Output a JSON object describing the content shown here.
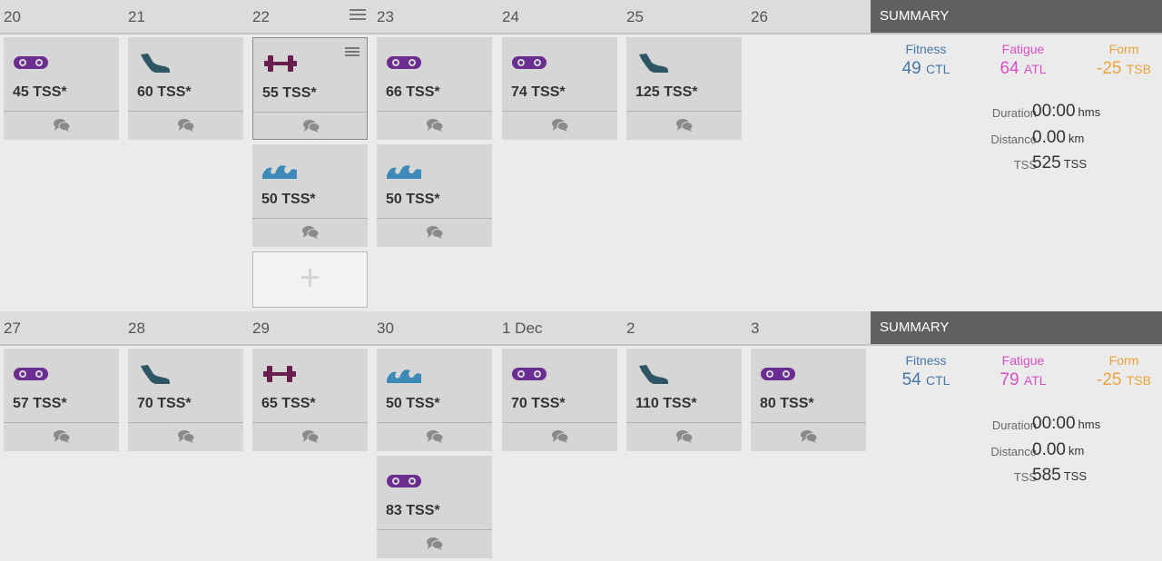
{
  "weeks": [
    {
      "days": [
        "20",
        "21",
        "22",
        "23",
        "24",
        "25",
        "26"
      ],
      "summary": {
        "title": "SUMMARY",
        "fitness": {
          "label": "Fitness",
          "value": "49",
          "unit": "CTL"
        },
        "fatigue": {
          "label": "Fatigue",
          "value": "64",
          "unit": "ATL"
        },
        "form": {
          "label": "Form",
          "value": "-25",
          "unit": "TSB"
        },
        "duration": {
          "label": "Duration",
          "value": "00:00",
          "unit": "hms"
        },
        "distance": {
          "label": "Distance",
          "value": "0.00",
          "unit": "km"
        },
        "tss": {
          "label": "TSS",
          "value": "525",
          "unit": "TSS"
        }
      },
      "workouts": [
        {
          "day": 0,
          "row": 0,
          "type": "bike-icon",
          "tss": "45 TSS*"
        },
        {
          "day": 1,
          "row": 0,
          "type": "run-icon",
          "tss": "60 TSS*"
        },
        {
          "day": 2,
          "row": 0,
          "type": "strength-icon",
          "tss": "55 TSS*",
          "selected": true
        },
        {
          "day": 2,
          "row": 1,
          "type": "swim-icon",
          "tss": "50 TSS*"
        },
        {
          "day": 3,
          "row": 0,
          "type": "bike-icon",
          "tss": "66 TSS*"
        },
        {
          "day": 3,
          "row": 1,
          "type": "swim-icon",
          "tss": "50 TSS*"
        },
        {
          "day": 4,
          "row": 0,
          "type": "bike-icon",
          "tss": "74 TSS*"
        },
        {
          "day": 5,
          "row": 0,
          "type": "run-icon",
          "tss": "125 TSS*"
        }
      ],
      "add_button": {
        "day": 2,
        "label": "+"
      }
    },
    {
      "days": [
        "27",
        "28",
        "29",
        "30",
        "1 Dec",
        "2",
        "3"
      ],
      "summary": {
        "title": "SUMMARY",
        "fitness": {
          "label": "Fitness",
          "value": "54",
          "unit": "CTL"
        },
        "fatigue": {
          "label": "Fatigue",
          "value": "79",
          "unit": "ATL"
        },
        "form": {
          "label": "Form",
          "value": "-25",
          "unit": "TSB"
        },
        "duration": {
          "label": "Duration",
          "value": "00:00",
          "unit": "hms"
        },
        "distance": {
          "label": "Distance",
          "value": "0.00",
          "unit": "km"
        },
        "tss": {
          "label": "TSS",
          "value": "585",
          "unit": "TSS"
        }
      },
      "workouts": [
        {
          "day": 0,
          "row": 0,
          "type": "bike-icon",
          "tss": "57 TSS*"
        },
        {
          "day": 1,
          "row": 0,
          "type": "run-icon",
          "tss": "70 TSS*"
        },
        {
          "day": 2,
          "row": 0,
          "type": "strength-icon",
          "tss": "65 TSS*"
        },
        {
          "day": 3,
          "row": 0,
          "type": "swim-icon",
          "tss": "50 TSS*"
        },
        {
          "day": 3,
          "row": 1,
          "type": "bike-icon",
          "tss": "83 TSS*"
        },
        {
          "day": 4,
          "row": 0,
          "type": "bike-icon",
          "tss": "70 TSS*"
        },
        {
          "day": 5,
          "row": 0,
          "type": "run-icon",
          "tss": "110 TSS*"
        },
        {
          "day": 6,
          "row": 0,
          "type": "bike-icon",
          "tss": "80 TSS*"
        }
      ]
    }
  ],
  "colors": {
    "bike": "#6b2d8f",
    "run": "#2e5563",
    "strength": "#6a1e4f",
    "swim": "#3d8ab8",
    "fitness": "#4a78a6",
    "fatigue": "#d94fc4",
    "form": "#eaa33c"
  }
}
